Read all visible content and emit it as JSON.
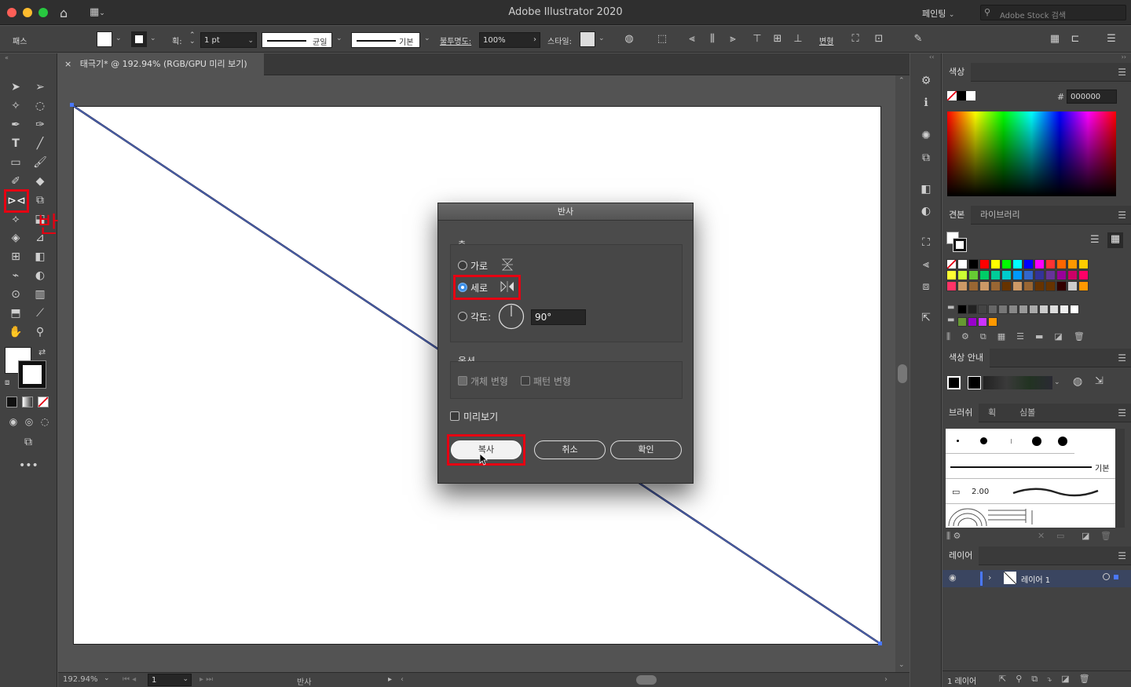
{
  "window": {
    "title": "Adobe Illustrator 2020",
    "workspace": "페인팅",
    "stock_search_placeholder": "Adobe Stock 검색"
  },
  "control": {
    "object_type": "패스",
    "stroke_label": "획:",
    "stroke_weight": "1 pt",
    "profile_uniform": "균일",
    "brush_basic": "기본",
    "opacity_label": "불투명도:",
    "opacity_value": "100%",
    "style_label": "스타일:",
    "transform_label": "변형"
  },
  "document": {
    "tab_title": "태극기* @ 192.94% (RGB/GPU 미리 보기)",
    "close_glyph": "×"
  },
  "status": {
    "zoom": "192.94%",
    "artboard_num": "1",
    "tool_name": "반사"
  },
  "annotation": {
    "text": "반사 도구(O)",
    "color": "#e60012"
  },
  "dialog": {
    "title": "반사",
    "axis_label": "축",
    "horizontal_label": "가로",
    "vertical_label": "세로",
    "angle_label": "각도:",
    "angle_value": "90°",
    "options_label": "옵션",
    "transform_objects_label": "개체 변형",
    "transform_patterns_label": "패턴 변형",
    "preview_label": "미리보기",
    "copy_label": "복사",
    "cancel_label": "취소",
    "ok_label": "확인",
    "selected_axis": "세로"
  },
  "color_panel": {
    "title": "색상",
    "hex_prefix": "#",
    "hex_value": "000000"
  },
  "swatches_panel": {
    "tab_swatches": "견본",
    "tab_libraries": "라이브러리",
    "row1": [
      "#ffffff",
      "#ffffff",
      "#000000",
      "#ff0000",
      "#ffff00",
      "#00ff00",
      "#00ffff",
      "#0000ff",
      "#ff00ff",
      "#ff3333",
      "#ff6600",
      "#ff9900",
      "#ffcc00"
    ],
    "row2": [
      "#ffff33",
      "#ccff33",
      "#66cc33",
      "#00cc66",
      "#00cc99",
      "#00cccc",
      "#0099ff",
      "#3366cc",
      "#333399",
      "#663399",
      "#990099",
      "#cc0066",
      "#ff0066"
    ],
    "row3": [
      "#ff3366",
      "#cc9966",
      "#996633",
      "#cc9966",
      "#996633",
      "#663300",
      "#cc9966",
      "#996633",
      "#663300",
      "#663300",
      "#330000",
      "#cccccc",
      "#ff9900"
    ],
    "grays": [
      "#000000",
      "#222222",
      "#444444",
      "#666666",
      "#777777",
      "#888888",
      "#999999",
      "#aaaaaa",
      "#cccccc",
      "#dddddd",
      "#eeeeee",
      "#ffffff"
    ],
    "extra": [
      "#669933",
      "#9900cc",
      "#cc33ff",
      "#ff9900"
    ]
  },
  "color_guide": {
    "title": "색상 안내"
  },
  "brushes_panel": {
    "tab_brush": "브러쉬",
    "tab_stroke": "획",
    "tab_symbol": "심볼",
    "basic_label": "기본",
    "size_value": "2.00"
  },
  "layers_panel": {
    "title": "레이어",
    "layer_name": "레이어 1",
    "footer_count": "1 레이어"
  },
  "accent": "#3a8ee6"
}
